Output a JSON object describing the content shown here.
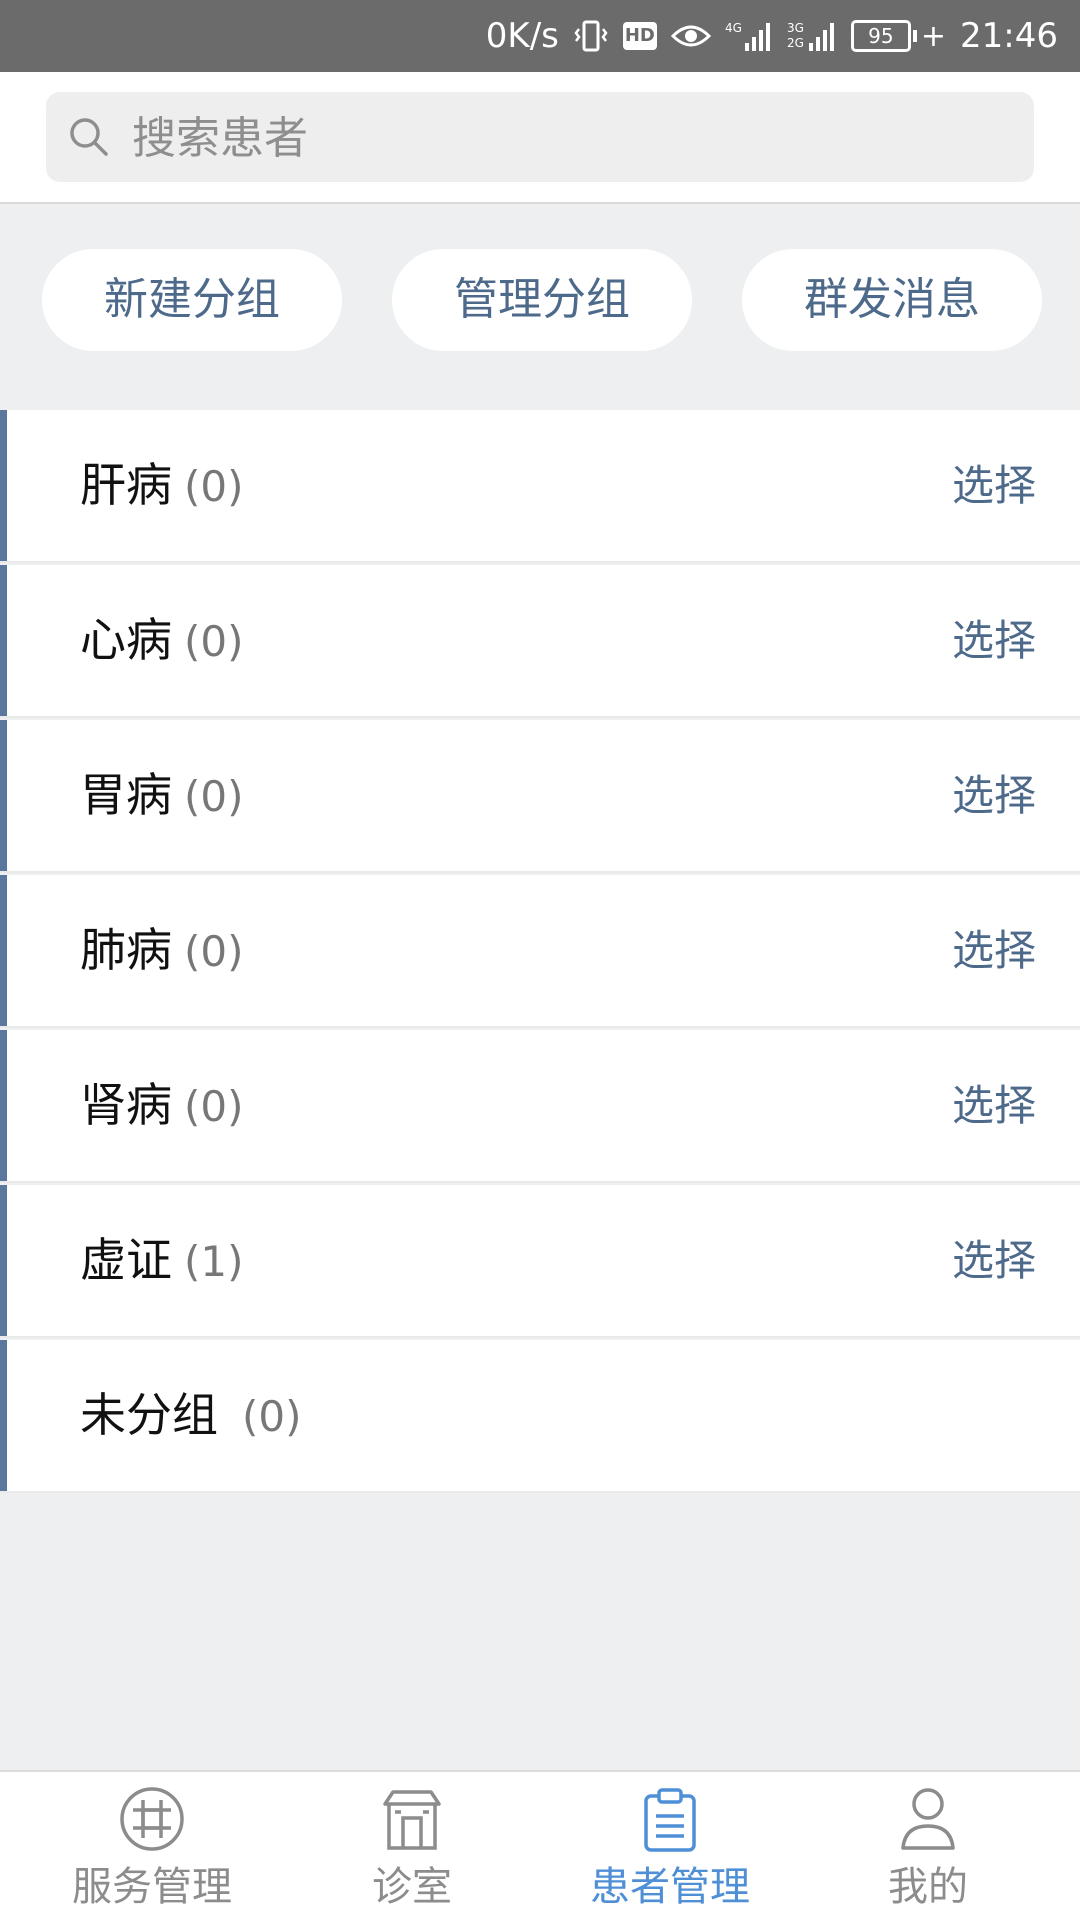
{
  "status_bar": {
    "speed": "0K/s",
    "hd": "HD",
    "net1": "4G",
    "net2": "3G 2G",
    "battery": "95",
    "time": "21:46"
  },
  "search": {
    "placeholder": "搜索患者"
  },
  "actions": {
    "new_group": "新建分组",
    "manage_group": "管理分组",
    "broadcast": "群发消息"
  },
  "groups": [
    {
      "name": "肝病",
      "count": "(0)",
      "action": "选择"
    },
    {
      "name": "心病",
      "count": "(0)",
      "action": "选择"
    },
    {
      "name": "胃病",
      "count": "(0)",
      "action": "选择"
    },
    {
      "name": "肺病",
      "count": "(0)",
      "action": "选择"
    },
    {
      "name": "肾病",
      "count": "(0)",
      "action": "选择"
    },
    {
      "name": "虚证",
      "count": "(1)",
      "action": "选择"
    },
    {
      "name": "未分组",
      "count": "(0)",
      "action": ""
    }
  ],
  "tabs": [
    {
      "label": "服务管理",
      "icon": "service-icon"
    },
    {
      "label": "诊室",
      "icon": "clinic-icon"
    },
    {
      "label": "患者管理",
      "icon": "clipboard-icon",
      "active": true
    },
    {
      "label": "我的",
      "icon": "person-icon"
    }
  ],
  "colors": {
    "accent_text": "#4e6a8b",
    "group_bar": "#5a779e",
    "tab_active": "#4f8fd6",
    "tab_inactive": "#8c8c8c",
    "page_bg": "#eeeff1"
  }
}
